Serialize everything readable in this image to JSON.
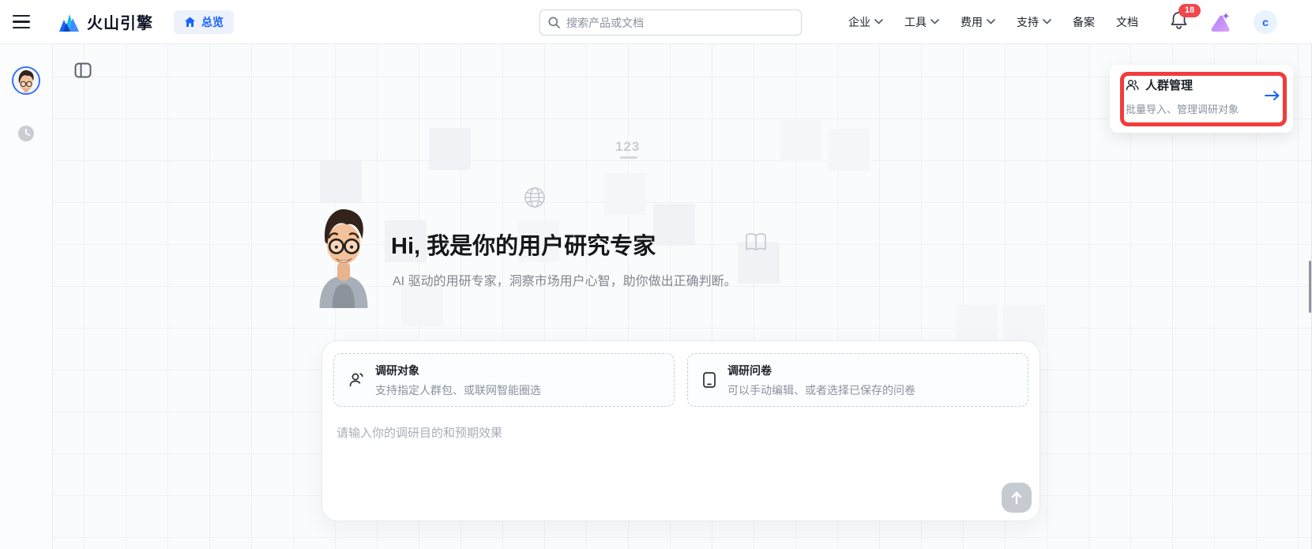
{
  "navbar": {
    "brand": "火山引擎",
    "overview_label": "总览",
    "search_placeholder": "搜索产品或文档",
    "menus": [
      {
        "label": "企业",
        "dropdown": true
      },
      {
        "label": "工具",
        "dropdown": true
      },
      {
        "label": "费用",
        "dropdown": true
      },
      {
        "label": "支持",
        "dropdown": true
      },
      {
        "label": "备案",
        "dropdown": false
      },
      {
        "label": "文档",
        "dropdown": false
      }
    ],
    "notification_count": "18",
    "avatar_initial": "c"
  },
  "annotation_card": {
    "title": "人群管理",
    "subtitle": "批量导入、管理调研对象"
  },
  "hero": {
    "title": "Hi, 我是你的用户研究专家",
    "subtitle": "AI 驱动的用研专家，洞察市场用户心智，助你做出正确判断。"
  },
  "composer": {
    "options": [
      {
        "title": "调研对象",
        "desc": "支持指定人群包、或联网智能圈选"
      },
      {
        "title": "调研问卷",
        "desc": "可以手动编辑、或者选择已保存的问卷"
      }
    ],
    "input_placeholder": "请输入你的调研目的和预期效果"
  },
  "background": {
    "counter_label": "123"
  },
  "colors": {
    "accent_blue": "#1664FF",
    "annotation_red": "#F23C3C",
    "badge_red": "#F0474D",
    "canvas_bg": "#FAFBFC"
  }
}
